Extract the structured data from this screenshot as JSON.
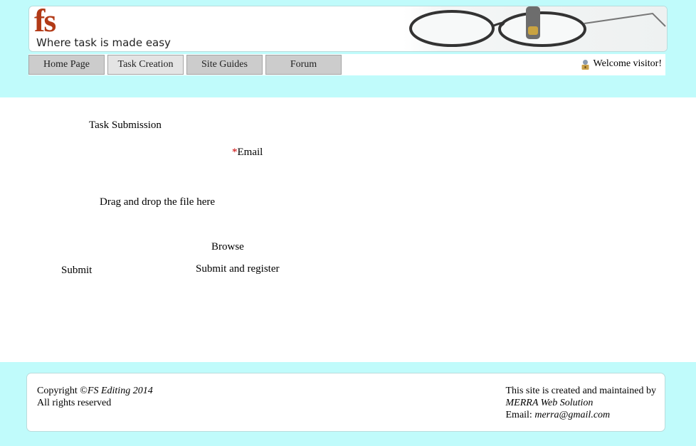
{
  "header": {
    "logo_mark": "fs",
    "tagline": "Where task is made easy"
  },
  "nav": {
    "items": [
      {
        "label": "Home Page"
      },
      {
        "label": "Task Creation"
      },
      {
        "label": "Site Guides"
      },
      {
        "label": "Forum"
      }
    ],
    "welcome": "Welcome visitor!"
  },
  "main": {
    "title": "Task Submission",
    "email_required_mark": "*",
    "email_label": "Email",
    "dropzone_text": "Drag and drop the file here",
    "browse_label": "Browse",
    "submit_label": "Submit",
    "submit_register_label": "Submit and register"
  },
  "footer": {
    "copyright_prefix": "Copyright ©",
    "copyright_name": "FS Editing 2014",
    "rights": "All rights reserved",
    "maintained_line": "This site is created and maintained by",
    "company": "MERRA Web Solution",
    "email_label": "Email: ",
    "email": "merra@gmail.com"
  },
  "colors": {
    "band": "#c0fbfb",
    "logo": "#b23a17",
    "required": "#cc0000",
    "nav_button": "#cccccc"
  }
}
